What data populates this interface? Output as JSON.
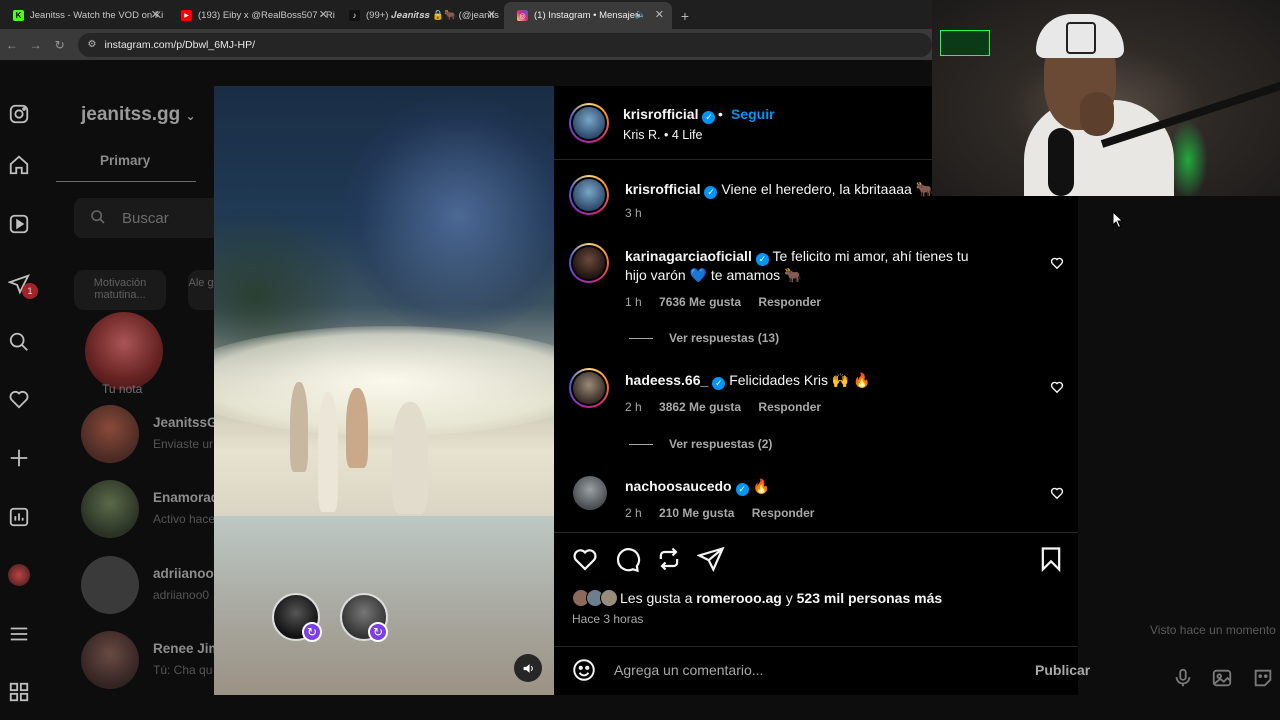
{
  "browser": {
    "tabs": [
      {
        "label": "Jeanitss - Watch the VOD on Ki",
        "fav": "K",
        "fav_color": "#53fc18"
      },
      {
        "label": "(193) Eiby x @RealBoss507 - Ri",
        "fav": "▶",
        "fav_color": "#ff0000"
      },
      {
        "label": "(99+) 𝑱𝒆𝒂𝒏𝒊𝒕𝒔𝒔 🔒🐂 (@jeanits",
        "fav": "♪",
        "fav_color": "#111111"
      },
      {
        "label": "(1) Instagram • Mensajes",
        "fav": "◎",
        "fav_color": "#d62976"
      }
    ],
    "url": "instagram.com/p/Dbwl_6MJ-HP/"
  },
  "dm": {
    "username": "jeanitss.gg",
    "tab_primary": "Primary",
    "search_placeholder": "Buscar",
    "chips": [
      "Motivación matutina...",
      "Ale gy..."
    ],
    "note_label": "Tu nota",
    "conversations": [
      {
        "name": "JeanitssG",
        "sub": "Enviaste ur"
      },
      {
        "name": "Enamorad",
        "sub": "Activo hace"
      },
      {
        "name": "adriianoo",
        "sub": "adriianoo0"
      },
      {
        "name": "Renee Jim",
        "sub": "Tú: Cha qu"
      }
    ],
    "seen": "Visto hace un momento"
  },
  "post": {
    "author": "krisrofficial",
    "follow_label": "Seguir",
    "dot": "•",
    "subtitle": "Kris R. • 4 Life",
    "caption_user": "krisrofficial",
    "caption_text": "Viene el heredero, la kbritaaaa 🐂",
    "caption_time": "3 h",
    "comments": [
      {
        "user": "karinagarciaoficiall",
        "text": "Te felicito mi amor, ahí tienes tu hijo varón 💙 te amamos 🐂",
        "time": "1 h",
        "likes": "7636 Me gusta",
        "reply": "Responder",
        "replies": "Ver respuestas (13)"
      },
      {
        "user": "hadeess.66_",
        "text": "Felicidades Kris 🙌 🔥",
        "time": "2 h",
        "likes": "3862 Me gusta",
        "reply": "Responder",
        "replies": "Ver respuestas (2)"
      },
      {
        "user": "nachoosaucedo",
        "text": "🔥",
        "time": "2 h",
        "likes": "210 Me gusta",
        "reply": "Responder"
      }
    ],
    "likes_prefix": "Les gusta a",
    "likes_user": "romerooo.ag",
    "likes_mid": "y",
    "likes_count": "523 mil personas más",
    "posted_when": "Hace 3 horas",
    "comment_placeholder": "Agrega un comentario...",
    "publish_label": "Publicar"
  }
}
